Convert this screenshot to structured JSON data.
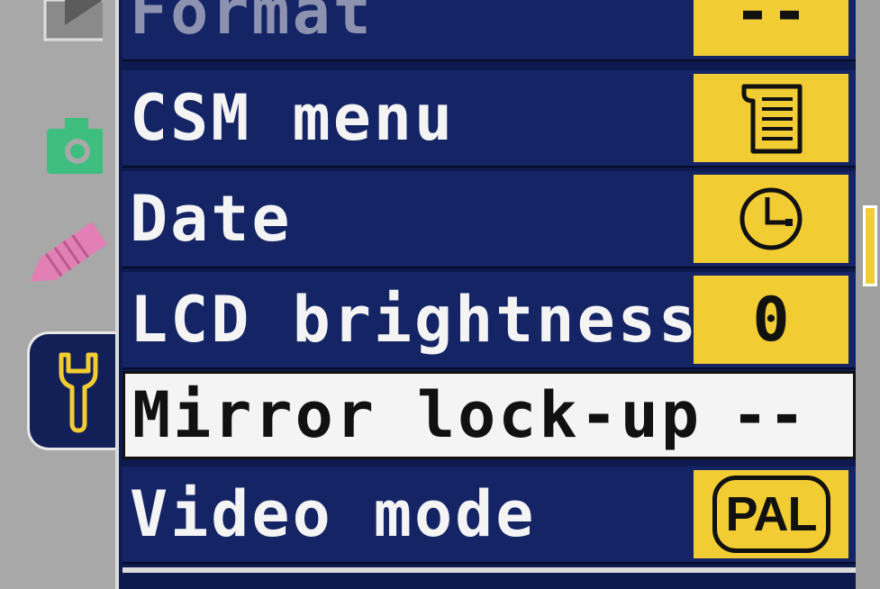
{
  "menu": {
    "items": [
      {
        "label": "Format",
        "value": "--",
        "icon": null
      },
      {
        "label": "CSM menu",
        "value": "",
        "icon": "csm-menu-icon"
      },
      {
        "label": "Date",
        "value": "",
        "icon": "clock-icon"
      },
      {
        "label": "LCD brightness",
        "value": "0",
        "icon": null
      },
      {
        "label": "Mirror lock-up",
        "value": "--",
        "icon": null
      },
      {
        "label": "Video mode",
        "value": "PAL",
        "icon": "pal-badge"
      }
    ],
    "selected_index": 4
  },
  "tabs": [
    {
      "name": "playback-tab",
      "icon": "play-icon"
    },
    {
      "name": "shooting-tab",
      "icon": "camera-icon"
    },
    {
      "name": "custom-settings-tab",
      "icon": "pencil-icon"
    },
    {
      "name": "setup-tab",
      "icon": "wrench-icon",
      "active": true
    }
  ],
  "colors": {
    "menu_background": "#142465",
    "value_background": "#f2cc33",
    "selected_background": "#f4f4f4",
    "camera_icon": "#3fbf7f",
    "pencil_icon": "#e27fb4",
    "wrench_icon": "#f2cc33"
  }
}
